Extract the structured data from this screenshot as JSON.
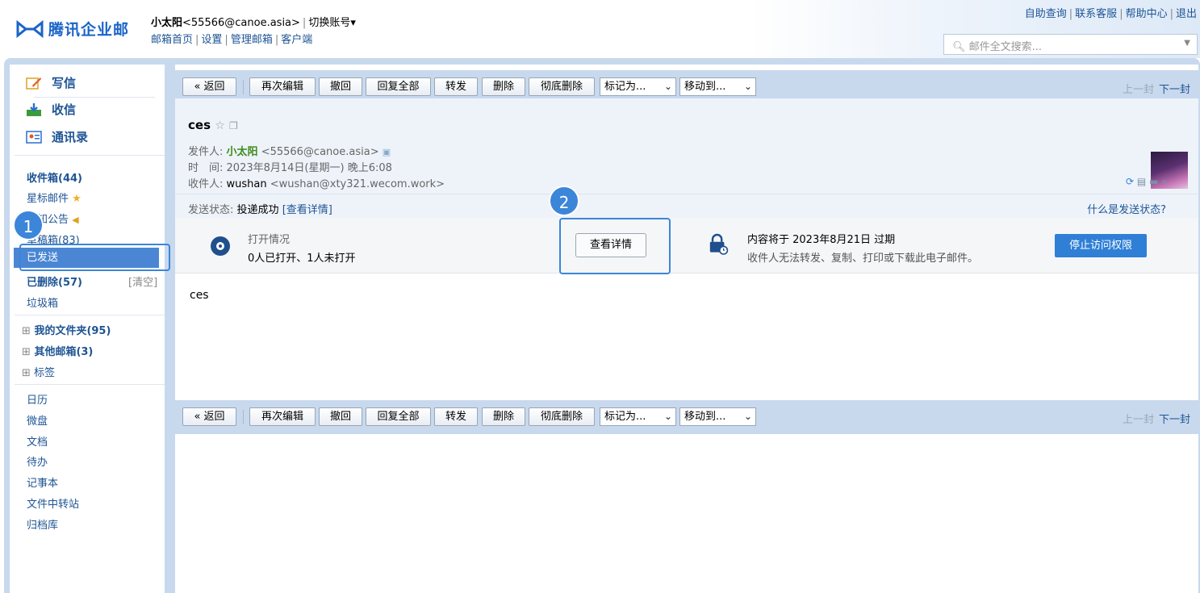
{
  "header": {
    "logo_text": "腾讯企业邮",
    "account_name": "小太阳",
    "account_email": "<55566@canoe.asia>",
    "switch_account": "切换账号▾",
    "links": [
      "邮箱首页",
      "设置",
      "管理邮箱",
      "客户端"
    ],
    "top_right_links": [
      "自助查询",
      "联系客服",
      "帮助中心",
      "退出"
    ],
    "search_placeholder": "邮件全文搜索..."
  },
  "sidebar": {
    "compose": [
      {
        "label": "写信",
        "icon": "pencil-icon"
      },
      {
        "label": "收信",
        "icon": "inbox-download-icon"
      },
      {
        "label": "通讯录",
        "icon": "contacts-icon"
      }
    ],
    "folders": {
      "inbox": "收件箱(44)",
      "starred": "星标邮件",
      "notice": "通知公告",
      "drafts": "草稿箱(83)",
      "sent": "已发送",
      "deleted": "已删除(57)",
      "clear": "[清空]",
      "spam": "垃圾箱"
    },
    "groups": [
      "我的文件夹(95)",
      "其他邮箱(3)",
      "标签"
    ],
    "apps": [
      "日历",
      "微盘",
      "文档",
      "待办",
      "记事本",
      "文件中转站",
      "归档库"
    ]
  },
  "toolbar": {
    "back": "« 返回",
    "buttons": [
      "再次编辑",
      "撤回",
      "回复全部",
      "转发",
      "删除",
      "彻底删除"
    ],
    "mark_as": "标记为...",
    "move_to": "移动到...",
    "prev": "上一封",
    "next": "下一封"
  },
  "mail": {
    "subject": "ces",
    "from_label": "发件人:",
    "from_name": "小太阳",
    "from_email": "<55566@canoe.asia>",
    "time_label": "时　间:",
    "time_value": "2023年8月14日(星期一) 晚上6:08",
    "to_label": "收件人:",
    "to_name": "wushan",
    "to_email": "<wushan@xty321.wecom.work>",
    "send_status_label": "发送状态:",
    "send_status_value": "投递成功",
    "send_status_link": "[查看详情]",
    "what_is_status": "什么是发送状态?",
    "open_title": "打开情况",
    "open_value": "0人已打开、1人未打开",
    "view_details": "查看详情",
    "expire_title": "内容将于 2023年8月21日 过期",
    "expire_desc": "收件人无法转发、复制、打印或下载此电子邮件。",
    "stop_access": "停止访问权限",
    "body": "ces"
  },
  "annotations": {
    "badge1": "1",
    "badge2": "2"
  },
  "colors": {
    "accent": "#3b86d8",
    "frame": "#c8d9ee",
    "link": "#1e5494",
    "sender_green": "#3b8b1a"
  }
}
